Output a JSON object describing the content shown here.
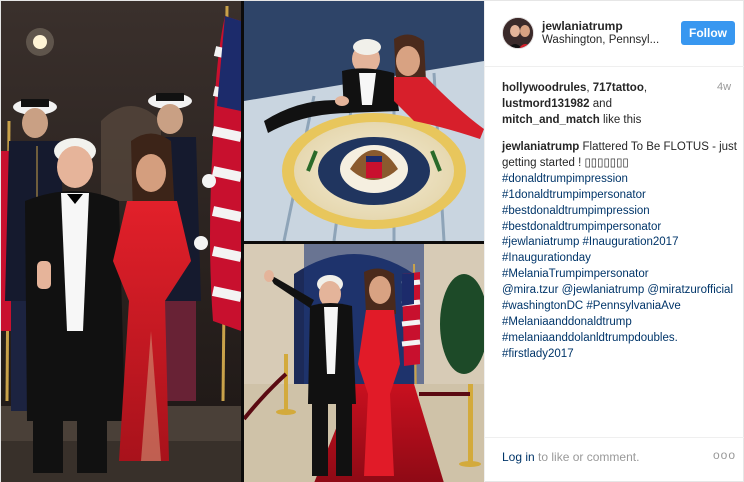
{
  "post": {
    "username": "jewlaniatrump",
    "location": "Washington, Pennsyl...",
    "follow_label": "Follow",
    "timestamp": "4w",
    "likes": {
      "likers": [
        "hollywoodrules",
        "717tattoo",
        "lustmord131982",
        "mitch_and_match"
      ],
      "sep1": ", ",
      "sep2": ", ",
      "and_text": " and",
      "suffix": " like this"
    },
    "caption": {
      "user": "jewlaniatrump",
      "text": "Flattered To Be FLOTUS - just getting started ! ▯▯▯▯▯▯▯",
      "lines": [
        "#donaldtrumpimpression",
        "#1donaldtrumpimpersonator",
        "#bestdonaldtrumpimpression",
        "#bestdonaldtrumpimpersonator",
        "#jewlaniatrump #Inauguration2017",
        "#Inaugurationday",
        "#MelaniaTrumpimpersonator",
        "@mira.tzur @jewlaniatrump @miratzurofficial",
        "#washingtonDC #PennsylvaniaAve",
        "#Melaniaanddonaldtrump",
        "#melaniaanddolanldtrumpdoubles.",
        "#firstlady2017"
      ]
    },
    "footer": {
      "login_link": "Log in",
      "login_rest": " to like or comment.",
      "more": "ooo"
    }
  },
  "media": {
    "seal_text": "SEAL OF THE PRESIDENT OF THE UNITED STATES"
  }
}
